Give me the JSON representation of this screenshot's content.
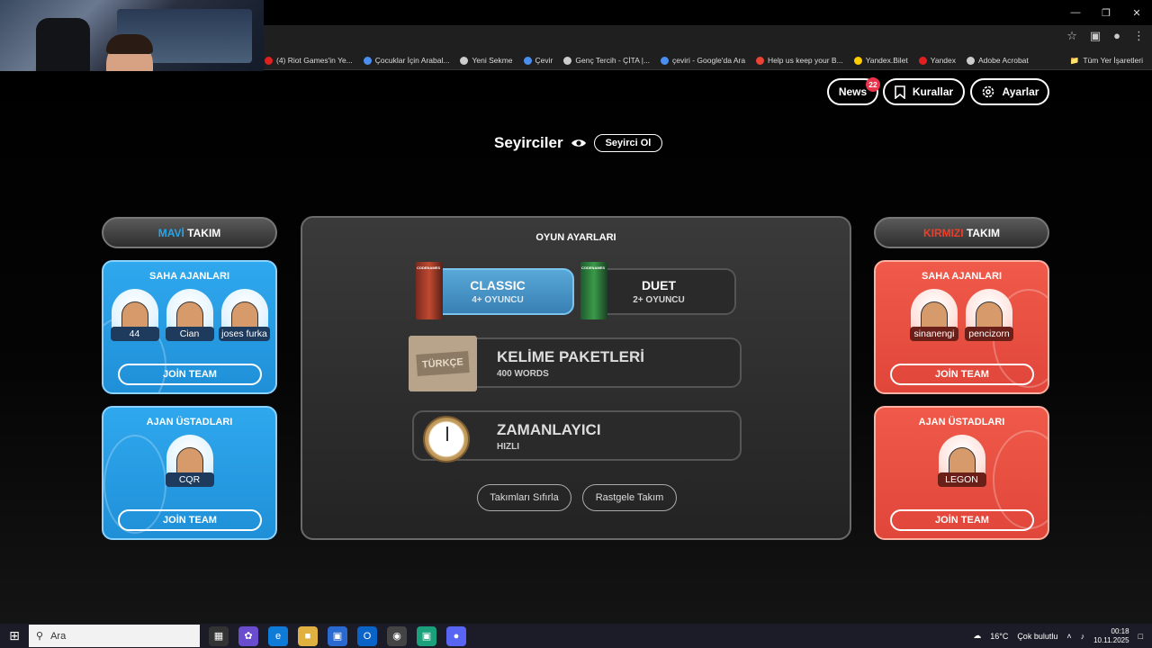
{
  "browser": {
    "bookmarks": [
      {
        "label": "(4) Riot Games'in Ye...",
        "color": "#e02020"
      },
      {
        "label": "Çocuklar İçin Arabal...",
        "color": "#4a8ef0"
      },
      {
        "label": "Yeni Sekme",
        "color": "#cccccc"
      },
      {
        "label": "Çevir",
        "color": "#4a8ef0"
      },
      {
        "label": "Genç Tercih - ÇİTA |...",
        "color": "#cccccc"
      },
      {
        "label": "çeviri - Google'da Ara",
        "color": "#4a8ef0"
      },
      {
        "label": "Help us keep your B...",
        "color": "#ea4335"
      },
      {
        "label": "Yandex.Bilet",
        "color": "#ffcc00"
      },
      {
        "label": "Yandex",
        "color": "#e02020"
      },
      {
        "label": "Adobe Acrobat",
        "color": "#cccccc"
      }
    ],
    "all_bookmarks": "Tüm Yer İşaretleri"
  },
  "header": {
    "news_label": "News",
    "news_badge": "22",
    "rules_label": "Kurallar",
    "settings_label": "Ayarlar"
  },
  "spectators": {
    "title": "Seyirciler",
    "button": "Seyirci Ol"
  },
  "blue_team": {
    "title_accent": "MAVİ",
    "title_rest": "TAKIM",
    "operatives_title": "SAHA AJANLARI",
    "operatives": [
      "44",
      "Cian",
      "joses furka"
    ],
    "spymasters_title": "AJAN ÜSTADLARI",
    "spymasters": [
      "CQR"
    ],
    "join_label": "JOİN TEAM"
  },
  "red_team": {
    "title_accent": "KIRMIZI",
    "title_rest": "TAKIM",
    "operatives_title": "SAHA AJANLARI",
    "operatives": [
      "sinanengi",
      "pencizorn"
    ],
    "spymasters_title": "AJAN ÜSTADLARI",
    "spymasters": [
      "LEGON"
    ],
    "join_label": "JOİN TEAM"
  },
  "game_settings": {
    "title": "OYUN AYARLARI",
    "modes": [
      {
        "title": "CLASSIC",
        "subtitle": "4+ OYUNCU",
        "selected": true
      },
      {
        "title": "DUET",
        "subtitle": "2+ OYUNCU",
        "selected": false
      }
    ],
    "box_label": "CODENAMES",
    "word_pack": {
      "title": "KELİME PAKETLERİ",
      "subtitle": "400 WORDS",
      "tag": "TÜRKÇE"
    },
    "timer": {
      "title": "ZAMANLAYICI",
      "subtitle": "HIZLI"
    },
    "reset_label": "Takımları Sıfırla",
    "random_label": "Rastgele Takım"
  },
  "taskbar": {
    "search_placeholder": "Ara",
    "weather_temp": "16°C",
    "weather_text": "Çok bulutlu",
    "time": "00:18",
    "date": "10.11.2025"
  },
  "colors": {
    "blue": "#2ba4e4",
    "red": "#e8402c",
    "badge": "#e8344a"
  }
}
